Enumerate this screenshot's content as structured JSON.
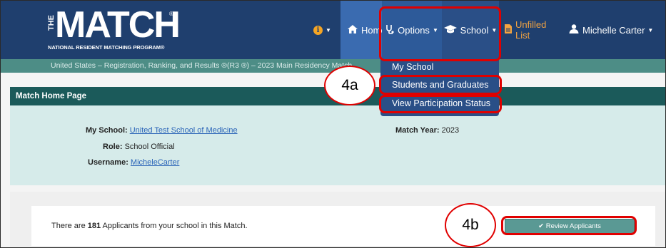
{
  "app": {
    "logo_the": "THE",
    "logo_match": "MATCH",
    "logo_registered": "®",
    "logo_subtitle": "NATIONAL RESIDENT MATCHING PROGRAM®"
  },
  "nav": {
    "info_glyph": "i",
    "home_label": "Home",
    "options_label": "Options",
    "school_label": "School",
    "unfilled_label": "Unfilled List",
    "user_label": "Michelle Carter"
  },
  "subbar": {
    "text": "United States  –  Registration, Ranking, and Results ®(R3 ®)  –  2023 Main Residency Match"
  },
  "dropdown": {
    "items": [
      "My School",
      "Students and Graduates",
      "View Participation Status"
    ]
  },
  "panel": {
    "title": "Match Home Page",
    "my_school_label": "My School:",
    "my_school_value": "United Test School of Medicine",
    "role_label": "Role:",
    "role_value": "School Official",
    "username_label": "Username:",
    "username_value": "MicheleCarter",
    "match_year_label": "Match Year:",
    "match_year_value": "2023"
  },
  "summary": {
    "prefix": "There are ",
    "count": "181",
    "suffix": " Applicants from your school in this Match."
  },
  "review_button": {
    "label": "Review Applicants"
  },
  "annotations": {
    "callout_a": "4a",
    "callout_b": "4b"
  },
  "colors": {
    "topbar": "#1f3f6e",
    "subbar": "#4d8d86",
    "panel_title": "#1b5a5a",
    "panel_body": "#d6ebea",
    "annotation": "#e00000",
    "unfilled": "#f2a341"
  },
  "icons": [
    "info-icon",
    "home-icon",
    "stethoscope-icon",
    "graduation-cap-icon",
    "document-icon",
    "user-icon",
    "check-icon"
  ]
}
